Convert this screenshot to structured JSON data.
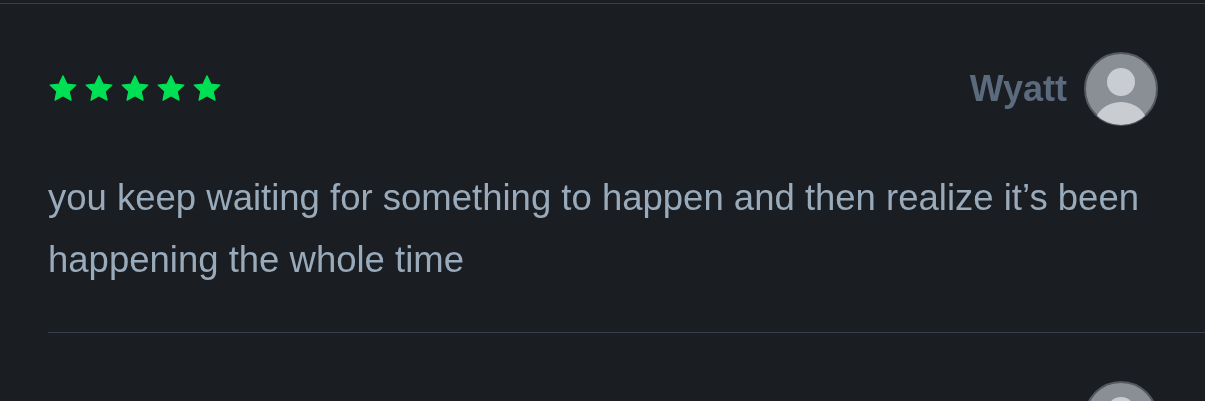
{
  "reviews": [
    {
      "stars": 5,
      "author": "Wyatt",
      "text": "you keep waiting for something to happen and then realize it’s been happening the whole time",
      "avatar": true
    },
    {
      "avatar": true
    }
  ]
}
